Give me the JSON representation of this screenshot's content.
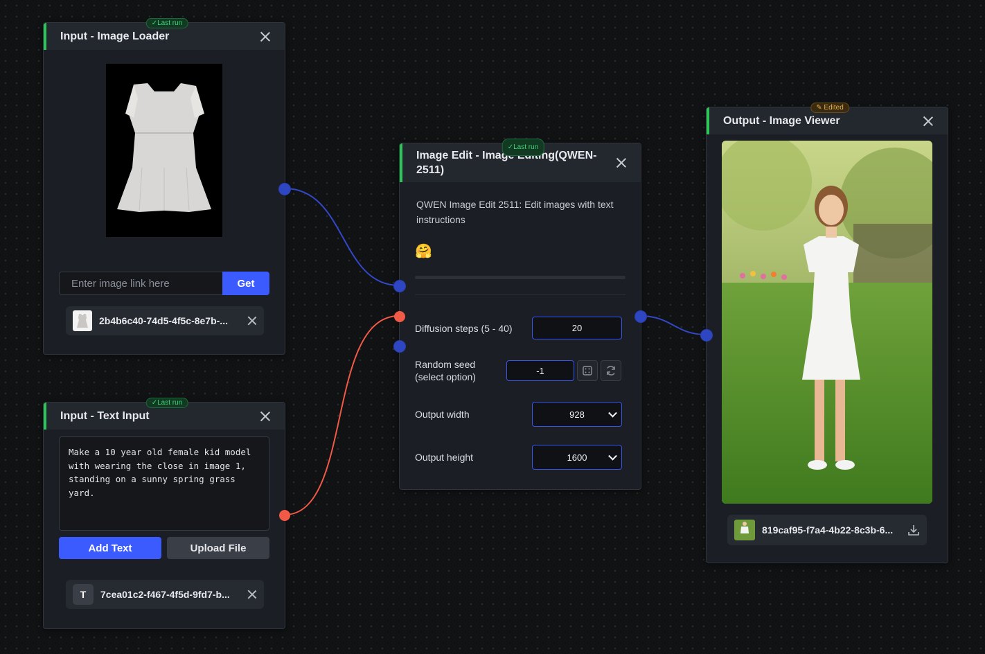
{
  "nodes": {
    "image_loader": {
      "title": "Input - Image Loader",
      "badge": "✓Last run",
      "link_placeholder": "Enter image link here",
      "get_label": "Get",
      "file_name": "2b4b6c40-74d5-4f5c-8e7b-..."
    },
    "text_input": {
      "title": "Input - Text Input",
      "badge": "✓Last run",
      "prompt": "Make a 10 year old female kid model with wearing the close in image 1, standing on a sunny spring grass yard.",
      "add_text_label": "Add Text",
      "upload_file_label": "Upload File",
      "file_icon_letter": "T",
      "file_name": "7cea01c2-f467-4f5d-9fd7-b..."
    },
    "image_edit": {
      "title": "Image Edit - Image Editing(QWEN-2511)",
      "badge": "✓Last run",
      "description": "QWEN Image Edit 2511: Edit images with text instructions",
      "emoji": "🤗",
      "params": {
        "diffusion_steps": {
          "label": "Diffusion steps (5 - 40)",
          "value": "20"
        },
        "random_seed": {
          "label": "Random seed (select option)",
          "value": "-1"
        },
        "output_width": {
          "label": "Output width",
          "value": "928"
        },
        "output_height": {
          "label": "Output height",
          "value": "1600"
        }
      }
    },
    "image_viewer": {
      "title": "Output - Image Viewer",
      "badge": "✎ Edited",
      "file_name": "819caf95-f7a4-4b22-8c3b-6..."
    }
  },
  "colors": {
    "canvas_bg": "#111214",
    "node_bg": "#1b1e24",
    "header_bg": "#23272e",
    "accent_green": "#2ec45a",
    "primary_button": "#3b5bff",
    "wire_image": "#3348c8",
    "wire_text": "#f05a46"
  }
}
